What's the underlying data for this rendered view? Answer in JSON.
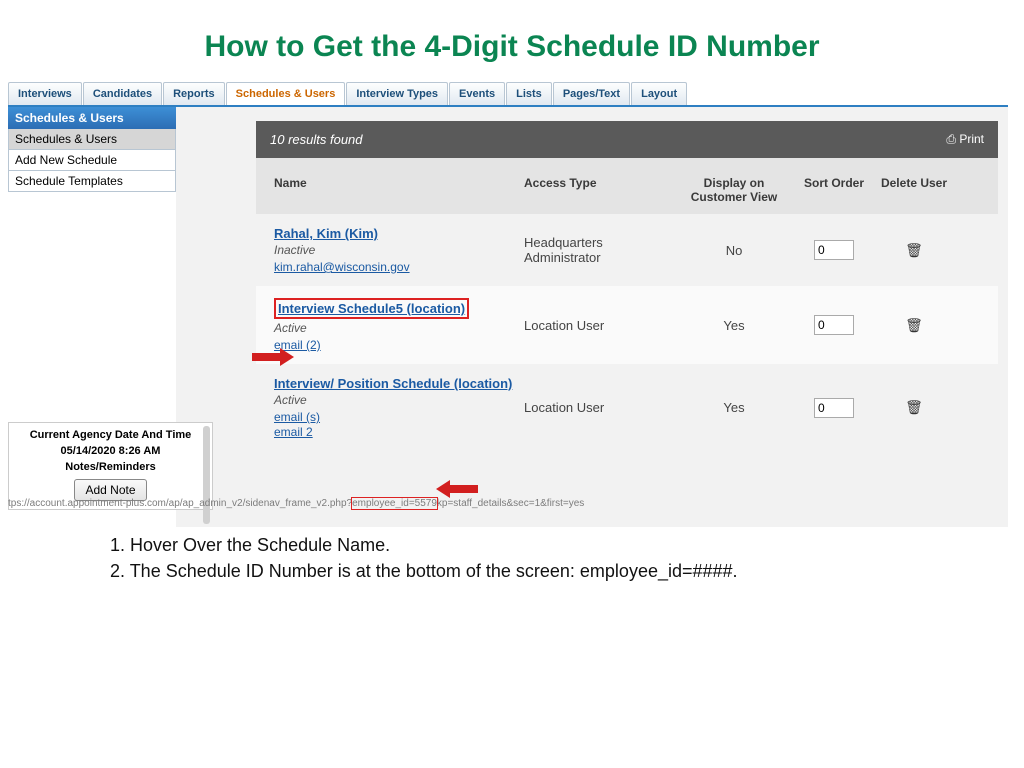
{
  "title": "How to Get the 4-Digit Schedule ID Number",
  "tabs": [
    "Interviews",
    "Candidates",
    "Reports",
    "Schedules & Users",
    "Interview Types",
    "Events",
    "Lists",
    "Pages/Text",
    "Layout"
  ],
  "activeTab": 3,
  "sidebar": {
    "header": "Schedules & Users",
    "items": [
      "Schedules & Users",
      "Add New Schedule",
      "Schedule Templates"
    ],
    "selected": 0
  },
  "sideBottom": {
    "dt_label": "Current Agency Date And Time",
    "dt_value": "05/14/2020 8:26 AM",
    "notes_label": "Notes/Reminders",
    "add_note": "Add Note"
  },
  "list": {
    "results_text": "10 results found",
    "print": "Print",
    "headers": {
      "name": "Name",
      "access": "Access Type",
      "disp": "Display on Customer View",
      "sort": "Sort Order",
      "del": "Delete User"
    },
    "rows": [
      {
        "name": "Rahal, Kim (Kim)",
        "status": "Inactive",
        "emails": [
          "kim.rahal@wisconsin.gov"
        ],
        "access": "Headquarters Administrator",
        "disp": "No",
        "sort": "0",
        "highlight": false
      },
      {
        "name": "Interview Schedule5 (location)",
        "status": "Active",
        "emails": [
          "email (2)"
        ],
        "access": "Location User",
        "disp": "Yes",
        "sort": "0",
        "highlight": true
      },
      {
        "name": "Interview/ Position Schedule (location)",
        "status": "Active",
        "emails": [
          "email (s)",
          "email 2"
        ],
        "access": "Location User",
        "disp": "Yes",
        "sort": "0",
        "highlight": false
      }
    ]
  },
  "url": {
    "pre": "tps://account.appointment-plus.com/ap/ap_admin_v2/sidenav_frame_v2.php?",
    "hl": "employee_id=5579",
    "post": "kp=staff_details&sec=1&first=yes"
  },
  "steps": [
    "1. Hover Over the Schedule Name.",
    "2. The Schedule ID Number is at the bottom of the screen: employee_id=####."
  ]
}
